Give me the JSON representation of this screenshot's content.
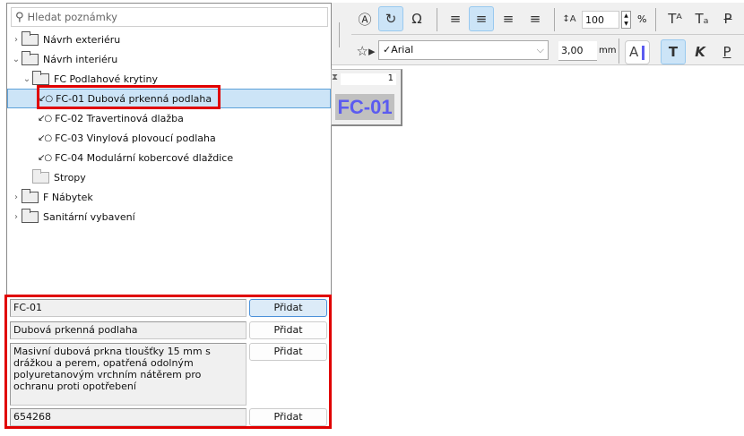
{
  "search": {
    "placeholder": "Hledat poznámky"
  },
  "tree": [
    {
      "label": "Návrh exteriéru",
      "level": 0,
      "expanded": false
    },
    {
      "label": "Návrh interiéru",
      "level": 0,
      "expanded": true
    },
    {
      "label": "FC Podlahové krytiny",
      "level": 1,
      "expanded": true
    },
    {
      "label": "FC-01 Dubová prkenná podlaha",
      "level": 2,
      "selected": true
    },
    {
      "label": "FC-02 Travertinová dlažba",
      "level": 2
    },
    {
      "label": "FC-03 Vinylová plovoucí podlaha",
      "level": 2
    },
    {
      "label": "FC-04 Modulární kobercové dlaždice",
      "level": 2
    },
    {
      "label": "Stropy",
      "level": 1
    },
    {
      "label": "F Nábytek",
      "level": 0,
      "expanded": false
    },
    {
      "label": "Sanitární vybavení",
      "level": 0,
      "expanded": false
    }
  ],
  "detail": {
    "code": "FC-01",
    "name": "Dubová prkenná podlaha",
    "description": "Masivní dubová prkna tloušťky 15 mm s drážkou a perem, opatřená odolným polyuretanovým vrchním nátěrem pro ochranu proti opotřebení",
    "number": "654268",
    "add_label": "Přidat"
  },
  "toolbar": {
    "spacing_value": "100",
    "spacing_unit": "%",
    "font": "Arial",
    "size_value": "3,00",
    "size_unit": "mm",
    "color_letter": "A",
    "bold": "T",
    "italic": "K",
    "underline": "P"
  },
  "tag": {
    "index": "1",
    "code": "FC-01"
  },
  "colors": {
    "selection": "#cce4f7",
    "highlight": "#e00000",
    "tag_text": "#5b5bf0"
  }
}
